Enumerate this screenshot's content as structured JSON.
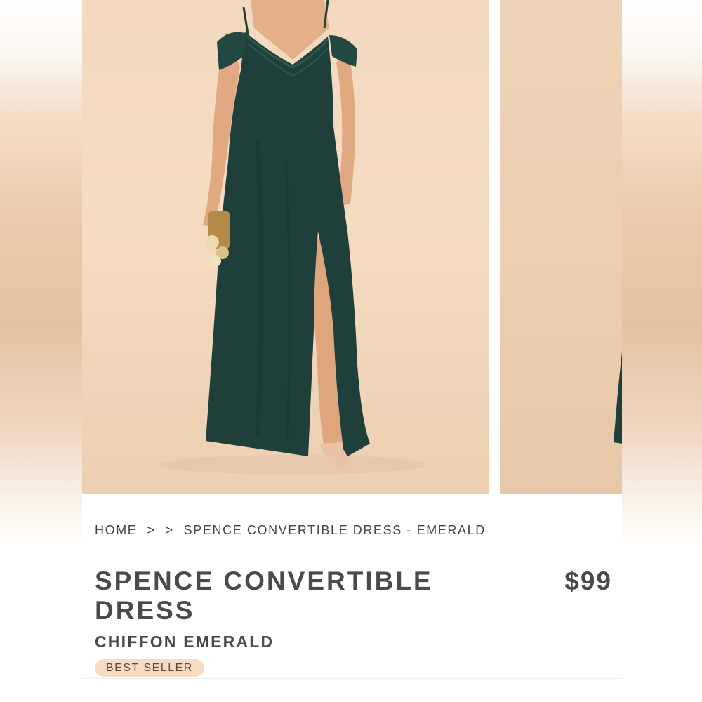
{
  "breadcrumb": {
    "home": "HOME",
    "separator": ">",
    "current": "SPENCE CONVERTIBLE DRESS - EMERALD"
  },
  "product": {
    "title": "SPENCE CONVERTIBLE DRESS",
    "price": "$99",
    "subtitle": "CHIFFON EMERALD",
    "badge": "BEST SELLER"
  },
  "colors": {
    "dress": "#1f3f3a",
    "backdrop": "#f2d9bf",
    "badge": "#f7dcc4",
    "text": "#4a4a4a"
  }
}
